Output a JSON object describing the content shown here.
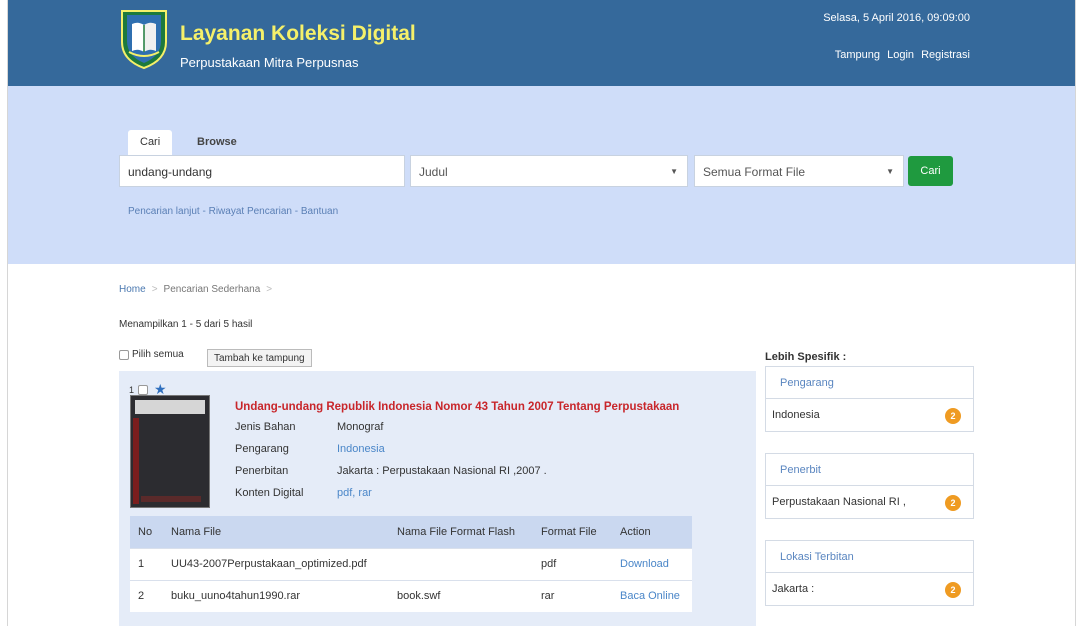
{
  "header": {
    "title": "Layanan Koleksi Digital",
    "subtitle": "Perpustakaan Mitra Perpusnas",
    "datetime": "Selasa, 5 April 2016, 09:09:00",
    "nav": [
      "Tampung",
      "Login",
      "Registrasi"
    ]
  },
  "search": {
    "tabs": [
      "Cari",
      "Browse"
    ],
    "query": "undang-undang",
    "field": "Judul",
    "format": "Semua Format File",
    "button": "Cari",
    "links": [
      "Pencarian lanjut",
      "Riwayat Pencarian",
      "Bantuan"
    ]
  },
  "breadcrumb": [
    "Home",
    "Pencarian Sederhana"
  ],
  "result_count": "Menampilkan 1 - 5 dari 5 hasil",
  "select_all": "Pilih semua",
  "add_button": "Tambah ke tampung",
  "result": {
    "number": "1",
    "title": "Undang-undang Republik Indonesia Nomor 43 Tahun 2007 Tentang Perpustakaan",
    "meta": [
      {
        "key": "Jenis Bahan",
        "value": "Monograf",
        "link": false
      },
      {
        "key": "Pengarang",
        "value": "Indonesia",
        "link": true
      },
      {
        "key": "Penerbitan",
        "value": "Jakarta : Perpustakaan Nasional RI ,2007 .",
        "link": false
      },
      {
        "key": "Konten Digital",
        "value": "pdf, rar",
        "link": true
      }
    ],
    "files_header": [
      "No",
      "Nama File",
      "Nama File Format Flash",
      "Format File",
      "Action"
    ],
    "files": [
      [
        "1",
        "UU43-2007Perpustakaan_optimized.pdf",
        "",
        "pdf",
        "Download"
      ],
      [
        "2",
        "buku_uuno4tahun1990.rar",
        "book.swf",
        "rar",
        "Baca Online"
      ]
    ]
  },
  "sidebar": {
    "title": "Lebih Spesifik :",
    "facets": [
      {
        "head": "Pengarang",
        "item": "Indonesia",
        "count": "2"
      },
      {
        "head": "Penerbit",
        "item": "Perpustakaan Nasional RI ,",
        "count": "2"
      },
      {
        "head": "Lokasi Terbitan",
        "item": "Jakarta :",
        "count": "2"
      }
    ]
  },
  "colors": {
    "header_bg": "#35699b",
    "title_yellow": "#f5f06a",
    "search_bg": "#cfddf9",
    "search_button": "#1f9a3f",
    "result_title": "#c8262b",
    "badge": "#ef9b22"
  }
}
